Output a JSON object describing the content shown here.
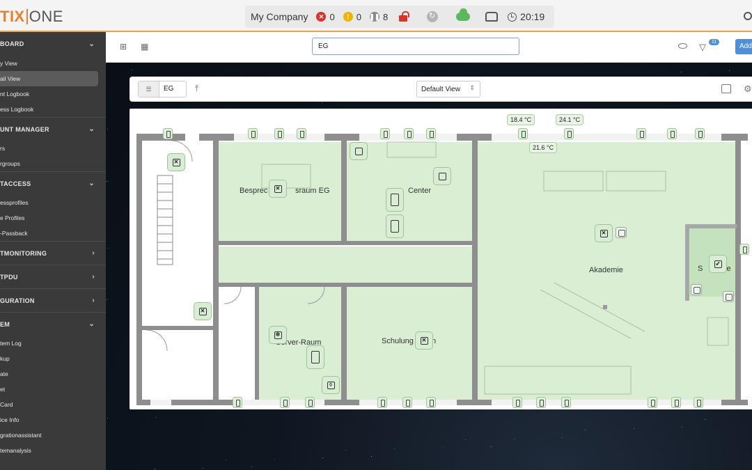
{
  "app": {
    "logo_tix": "TIX",
    "logo_one": "ONE",
    "company": "My Company",
    "counts": {
      "errors": "0",
      "warnings": "0",
      "paused": "8"
    },
    "time": "20:19",
    "colors": {
      "accent": "#f0a13a",
      "primary": "#4d8fd9",
      "error": "#d9342b",
      "ok": "#5cb85c"
    }
  },
  "sidebar": {
    "sections": [
      {
        "title": "BOARD",
        "chevron": "⌄",
        "items": [
          {
            "label": "y View",
            "active": false
          },
          {
            "label": "ail View",
            "active": true
          },
          {
            "label": "nt Logbook",
            "active": false
          },
          {
            "label": "ess Logbook",
            "active": false
          }
        ]
      },
      {
        "title": "UNT MANAGER",
        "chevron": "⌄",
        "items": [
          {
            "label": "rs"
          },
          {
            "label": "rgroups"
          }
        ]
      },
      {
        "title": "TACCESS",
        "chevron": "⌄",
        "items": [
          {
            "label": "essprofiles"
          },
          {
            "label": "e Profiles"
          },
          {
            "label": "-Passback"
          }
        ]
      },
      {
        "title": "TMONITORING",
        "chevron": "›",
        "items": []
      },
      {
        "title": "TPDU",
        "chevron": "›",
        "items": []
      },
      {
        "title": "GURATION",
        "chevron": "›",
        "items": []
      },
      {
        "title": "EM",
        "chevron": "⌄",
        "items": [
          {
            "label": "tem Log"
          },
          {
            "label": "kup"
          },
          {
            "label": "ate"
          },
          {
            "label": "et"
          },
          {
            "label": "Card"
          },
          {
            "label": "ice Info"
          },
          {
            "label": "grationassistant"
          },
          {
            "label": "temanalysis"
          }
        ]
      }
    ]
  },
  "toolbar": {
    "search_value": "EG",
    "filter_badge": "11",
    "add_label": "Add"
  },
  "floor_toolbar": {
    "floor_value": "EG",
    "view_select": "Default View"
  },
  "floorplan": {
    "temps": [
      "18.4 °C",
      "24.1 °C",
      "21.6 °C"
    ],
    "rooms": [
      "Besprec",
      "sraum EG",
      "Center",
      "Akademie",
      "S",
      "se",
      "Server-Raum",
      "Schulung",
      "n"
    ]
  }
}
